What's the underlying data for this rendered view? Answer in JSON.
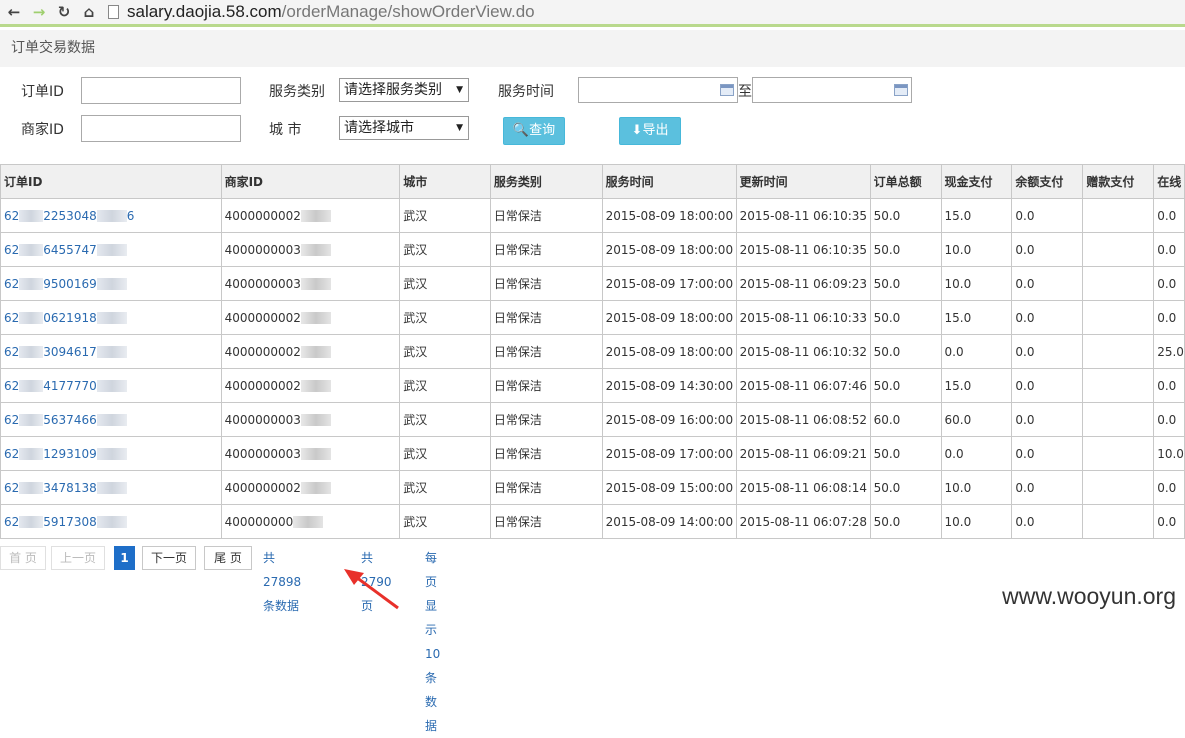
{
  "browser": {
    "url_host": "salary.daojia.58.com",
    "url_path": "/orderManage/showOrderView.do"
  },
  "page": {
    "title": "订单交易数据"
  },
  "filters": {
    "order_id_label": "订单ID",
    "service_type_label": "服务类别",
    "service_type_value": "请选择服务类别",
    "service_time_label": "服务时间",
    "to_label": "至",
    "merchant_id_label": "商家ID",
    "city_label": "城 市",
    "city_value": "请选择城市",
    "query_label": "查询",
    "export_label": "导出"
  },
  "table": {
    "columns": [
      "订单ID",
      "商家ID",
      "城市",
      "服务类别",
      "服务时间",
      "更新时间",
      "订单总额",
      "现金支付",
      "余额支付",
      "赠款支付",
      "在线"
    ],
    "rows": [
      {
        "order_a": "62",
        "order_b": "2253048",
        "order_c": "6",
        "merchant": "4000000002",
        "city": "武汉",
        "service": "日常保洁",
        "service_time": "2015-08-09 18:00:00",
        "update_time": "2015-08-11 06:10:35",
        "total": "50.0",
        "cash": "15.0",
        "balance": "0.0",
        "gift": "",
        "online": "0.0"
      },
      {
        "order_a": "62",
        "order_b": "6455747",
        "order_c": "",
        "merchant": "4000000003",
        "city": "武汉",
        "service": "日常保洁",
        "service_time": "2015-08-09 18:00:00",
        "update_time": "2015-08-11 06:10:35",
        "total": "50.0",
        "cash": "10.0",
        "balance": "0.0",
        "gift": "",
        "online": "0.0"
      },
      {
        "order_a": "62",
        "order_b": "9500169",
        "order_c": "",
        "merchant": "4000000003",
        "city": "武汉",
        "service": "日常保洁",
        "service_time": "2015-08-09 17:00:00",
        "update_time": "2015-08-11 06:09:23",
        "total": "50.0",
        "cash": "10.0",
        "balance": "0.0",
        "gift": "",
        "online": "0.0"
      },
      {
        "order_a": "62",
        "order_b": "0621918",
        "order_c": "",
        "merchant": "4000000002",
        "city": "武汉",
        "service": "日常保洁",
        "service_time": "2015-08-09 18:00:00",
        "update_time": "2015-08-11 06:10:33",
        "total": "50.0",
        "cash": "15.0",
        "balance": "0.0",
        "gift": "",
        "online": "0.0"
      },
      {
        "order_a": "62",
        "order_b": "3094617",
        "order_c": "",
        "merchant": "4000000002",
        "city": "武汉",
        "service": "日常保洁",
        "service_time": "2015-08-09 18:00:00",
        "update_time": "2015-08-11 06:10:32",
        "total": "50.0",
        "cash": "0.0",
        "balance": "0.0",
        "gift": "",
        "online": "25.0"
      },
      {
        "order_a": "62",
        "order_b": "4177770",
        "order_c": "",
        "merchant": "4000000002",
        "city": "武汉",
        "service": "日常保洁",
        "service_time": "2015-08-09 14:30:00",
        "update_time": "2015-08-11 06:07:46",
        "total": "50.0",
        "cash": "15.0",
        "balance": "0.0",
        "gift": "",
        "online": "0.0"
      },
      {
        "order_a": "62",
        "order_b": "5637466",
        "order_c": "",
        "merchant": "4000000003",
        "city": "武汉",
        "service": "日常保洁",
        "service_time": "2015-08-09 16:00:00",
        "update_time": "2015-08-11 06:08:52",
        "total": "60.0",
        "cash": "60.0",
        "balance": "0.0",
        "gift": "",
        "online": "0.0"
      },
      {
        "order_a": "62",
        "order_b": "1293109",
        "order_c": "",
        "merchant": "4000000003",
        "city": "武汉",
        "service": "日常保洁",
        "service_time": "2015-08-09 17:00:00",
        "update_time": "2015-08-11 06:09:21",
        "total": "50.0",
        "cash": "0.0",
        "balance": "0.0",
        "gift": "",
        "online": "10.0"
      },
      {
        "order_a": "62",
        "order_b": "3478138",
        "order_c": "",
        "merchant": "4000000002",
        "city": "武汉",
        "service": "日常保洁",
        "service_time": "2015-08-09 15:00:00",
        "update_time": "2015-08-11 06:08:14",
        "total": "50.0",
        "cash": "10.0",
        "balance": "0.0",
        "gift": "",
        "online": "0.0"
      },
      {
        "order_a": "62",
        "order_b": "5917308",
        "order_c": "",
        "merchant": "400000000",
        "city": "武汉",
        "service": "日常保洁",
        "service_time": "2015-08-09 14:00:00",
        "update_time": "2015-08-11 06:07:28",
        "total": "50.0",
        "cash": "10.0",
        "balance": "0.0",
        "gift": "",
        "online": "0.0"
      }
    ]
  },
  "pagination": {
    "first": "首 页",
    "prev": "上一页",
    "current": "1",
    "next": "下一页",
    "last": "尾 页",
    "total_records": "共27898条数据",
    "total_pages": "共2790页",
    "per_page": "每页显示10条数据"
  },
  "watermark": "www.wooyun.org",
  "colors": {
    "accent": "#5bc0de",
    "link": "#2a6ab0",
    "active_page": "#1e6ec8",
    "annotation": "#e8302a"
  }
}
